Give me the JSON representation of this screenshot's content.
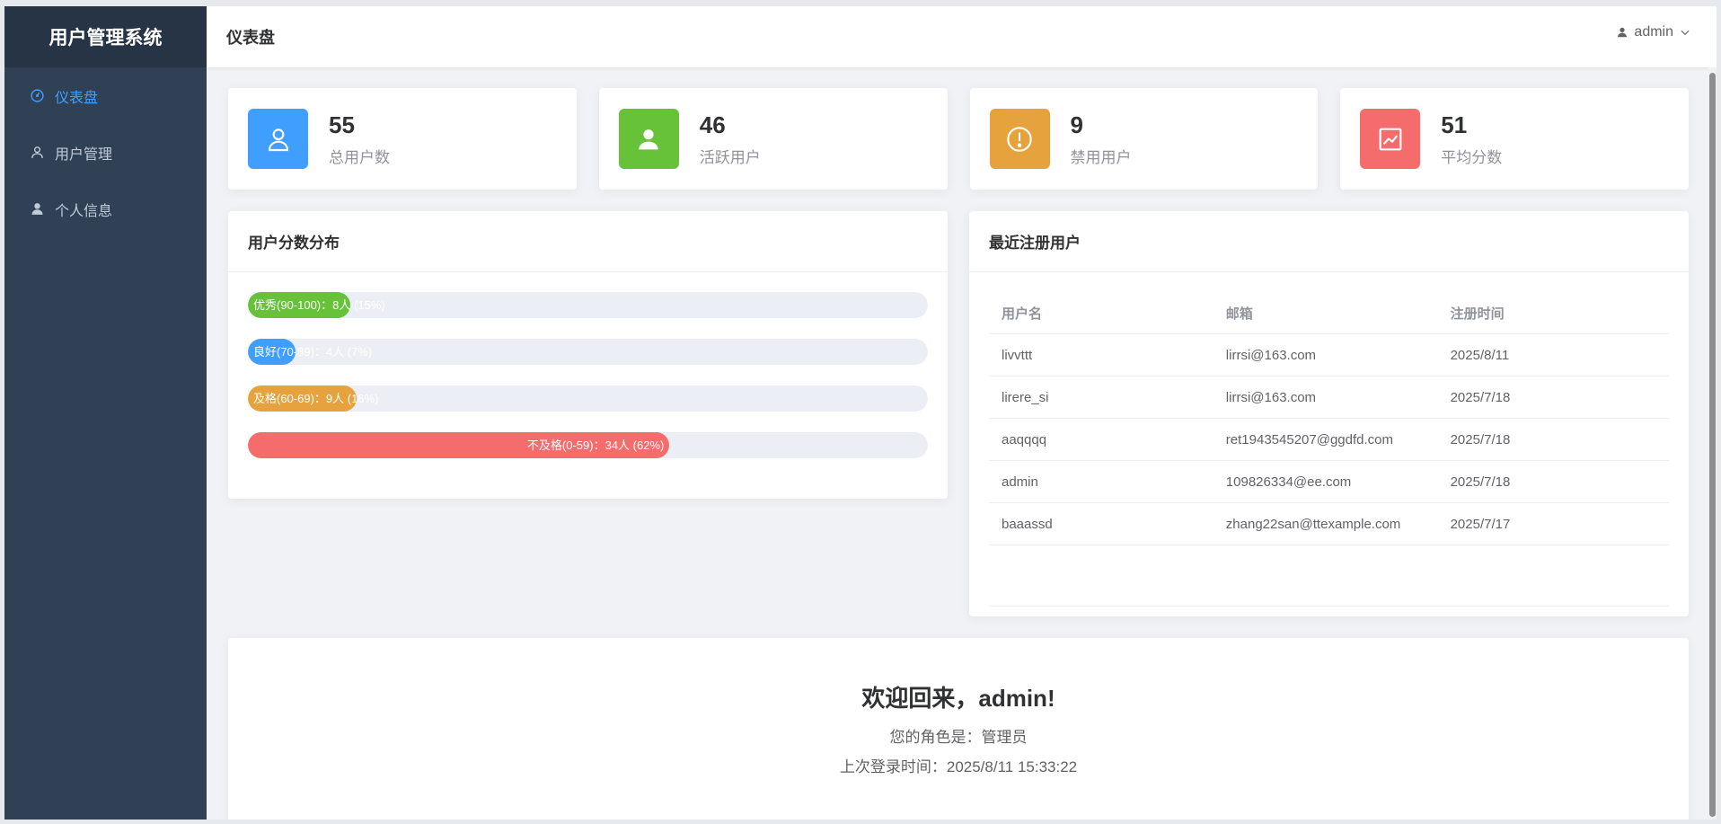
{
  "app": {
    "title": "用户管理系统"
  },
  "sidebar": {
    "items": [
      {
        "label": "仪表盘",
        "icon": "dashboard-icon",
        "active": true
      },
      {
        "label": "用户管理",
        "icon": "user-outline-icon",
        "active": false
      },
      {
        "label": "个人信息",
        "icon": "user-filled-icon",
        "active": false
      }
    ]
  },
  "header": {
    "title": "仪表盘",
    "user": "admin"
  },
  "stats": [
    {
      "value": "55",
      "label": "总用户数",
      "color": "#409eff",
      "icon": "user-outline-icon"
    },
    {
      "value": "46",
      "label": "活跃用户",
      "color": "#67c23a",
      "icon": "user-filled-icon"
    },
    {
      "value": "9",
      "label": "禁用用户",
      "color": "#e6a23c",
      "icon": "warning-icon"
    },
    {
      "value": "51",
      "label": "平均分数",
      "color": "#f56c6c",
      "icon": "trend-chart-icon"
    }
  ],
  "distribution": {
    "title": "用户分数分布",
    "bars": [
      {
        "label": "优秀(90-100)：8人 (15%)",
        "percent": 15,
        "color": "#67c23a",
        "align": "left"
      },
      {
        "label": "良好(70-89)：4人 (7%)",
        "percent": 7,
        "color": "#409eff",
        "align": "left"
      },
      {
        "label": "及格(60-69)：9人 (16%)",
        "percent": 16,
        "color": "#e6a23c",
        "align": "left"
      },
      {
        "label": "不及格(0-59)：34人 (62%)",
        "percent": 62,
        "color": "#f56c6c",
        "align": "right"
      }
    ]
  },
  "recent": {
    "title": "最近注册用户",
    "columns": [
      "用户名",
      "邮箱",
      "注册时间"
    ],
    "rows": [
      [
        "livvttt",
        "lirrsi@163.com",
        "2025/8/11"
      ],
      [
        "lirere_si",
        "lirrsi@163.com",
        "2025/7/18"
      ],
      [
        "aaqqqq",
        "ret1943545207@ggdfd.com",
        "2025/7/18"
      ],
      [
        "admin",
        "109826334@ee.com",
        "2025/7/18"
      ],
      [
        "baaassd",
        "zhang22san@ttexample.com",
        "2025/7/17"
      ]
    ]
  },
  "welcome": {
    "title": "欢迎回来，admin!",
    "role": "您的角色是：管理员",
    "last_login": "上次登录时间：2025/8/11 15:33:22"
  }
}
